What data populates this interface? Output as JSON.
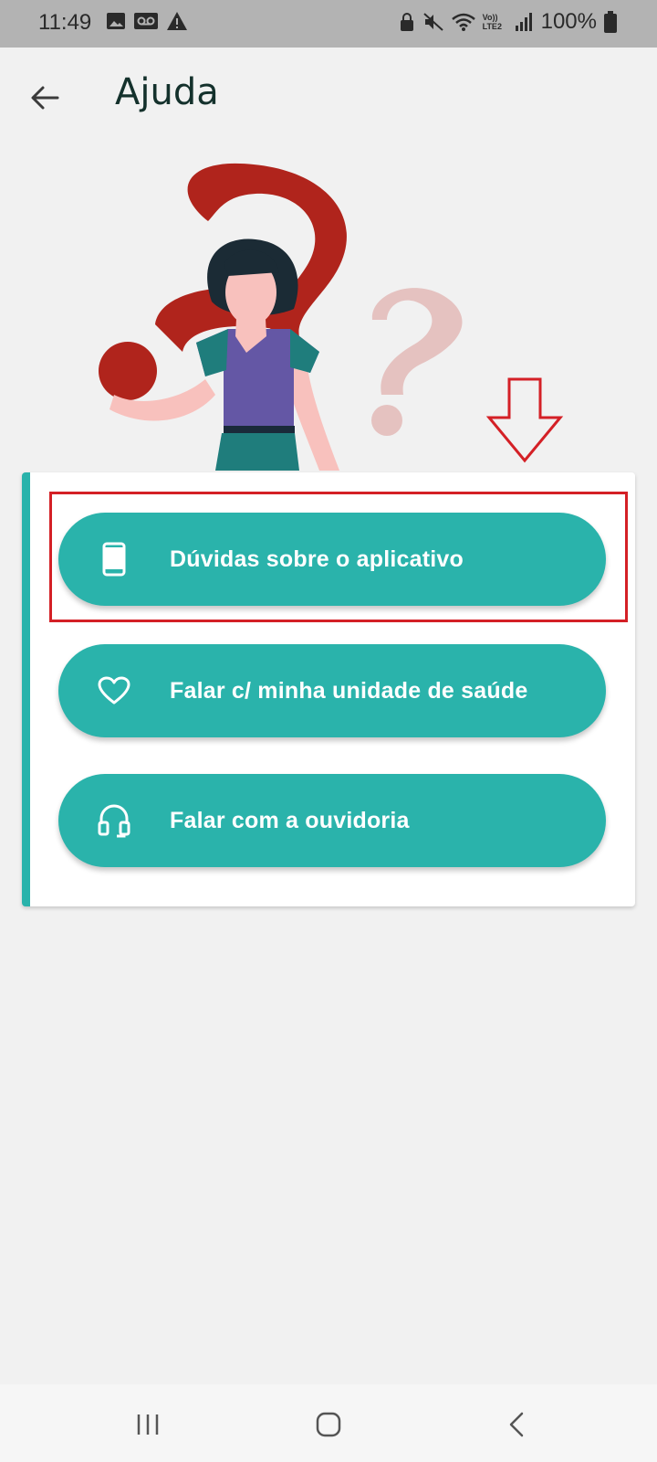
{
  "status_bar": {
    "time": "11:49",
    "battery": "100%",
    "left_icons": [
      "image-icon",
      "voicemail-icon",
      "warning-icon"
    ],
    "right_icons": [
      "lock-icon",
      "mute-icon",
      "wifi-icon",
      "volte-icon",
      "signal-icon",
      "battery-icon"
    ],
    "volte_label": "Vo)) LTE2"
  },
  "header": {
    "back_icon": "arrow-left-icon",
    "title": "Ajuda"
  },
  "illustration": {
    "description_icon": "woman-with-question-marks-illustration"
  },
  "help_options": [
    {
      "label": "Dúvidas sobre o aplicativo",
      "icon": "smartphone-icon"
    },
    {
      "label": "Falar c/ minha unidade de saúde",
      "icon": "heart-icon"
    },
    {
      "label": "Falar com a ouvidoria",
      "icon": "headset-icon"
    }
  ],
  "annotation": {
    "arrow_icon": "down-arrow-outline-icon",
    "highlight_color": "#d42026"
  },
  "nav_bar": {
    "icons": [
      "recent-apps-icon",
      "home-icon",
      "back-icon"
    ]
  },
  "colors": {
    "accent": "#2ab3ab",
    "title": "#14312c",
    "background": "#f1f1f1"
  }
}
